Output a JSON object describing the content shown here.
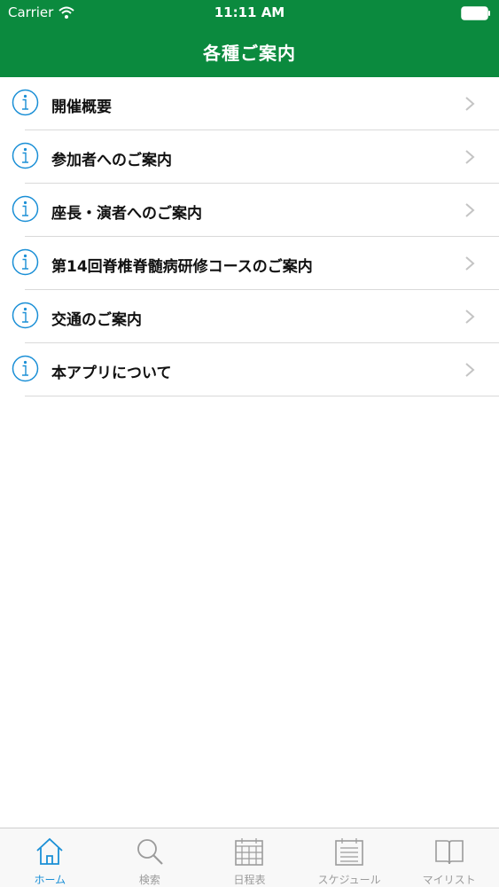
{
  "status_bar": {
    "carrier": "Carrier",
    "time": "11:11 AM"
  },
  "nav": {
    "title": "各種ご案内"
  },
  "list": {
    "items": [
      {
        "label": "開催概要",
        "icon": "info-icon"
      },
      {
        "label": "参加者へのご案内",
        "icon": "info-icon"
      },
      {
        "label": "座長・演者へのご案内",
        "icon": "info-icon"
      },
      {
        "label": "第14回脊椎脊髄病研修コースのご案内",
        "icon": "info-icon"
      },
      {
        "label": "交通のご案内",
        "icon": "info-icon"
      },
      {
        "label": "本アプリについて",
        "icon": "info-icon"
      }
    ]
  },
  "tabs": [
    {
      "label": "ホーム",
      "icon": "home-icon",
      "active": true
    },
    {
      "label": "検索",
      "icon": "search-icon",
      "active": false
    },
    {
      "label": "日程表",
      "icon": "calendar-icon",
      "active": false
    },
    {
      "label": "スケジュール",
      "icon": "schedule-list-icon",
      "active": false
    },
    {
      "label": "マイリスト",
      "icon": "book-icon",
      "active": false
    }
  ],
  "colors": {
    "header": "#0b8a3e",
    "accent": "#1a8fd6",
    "inactive": "#9b9b9b"
  }
}
